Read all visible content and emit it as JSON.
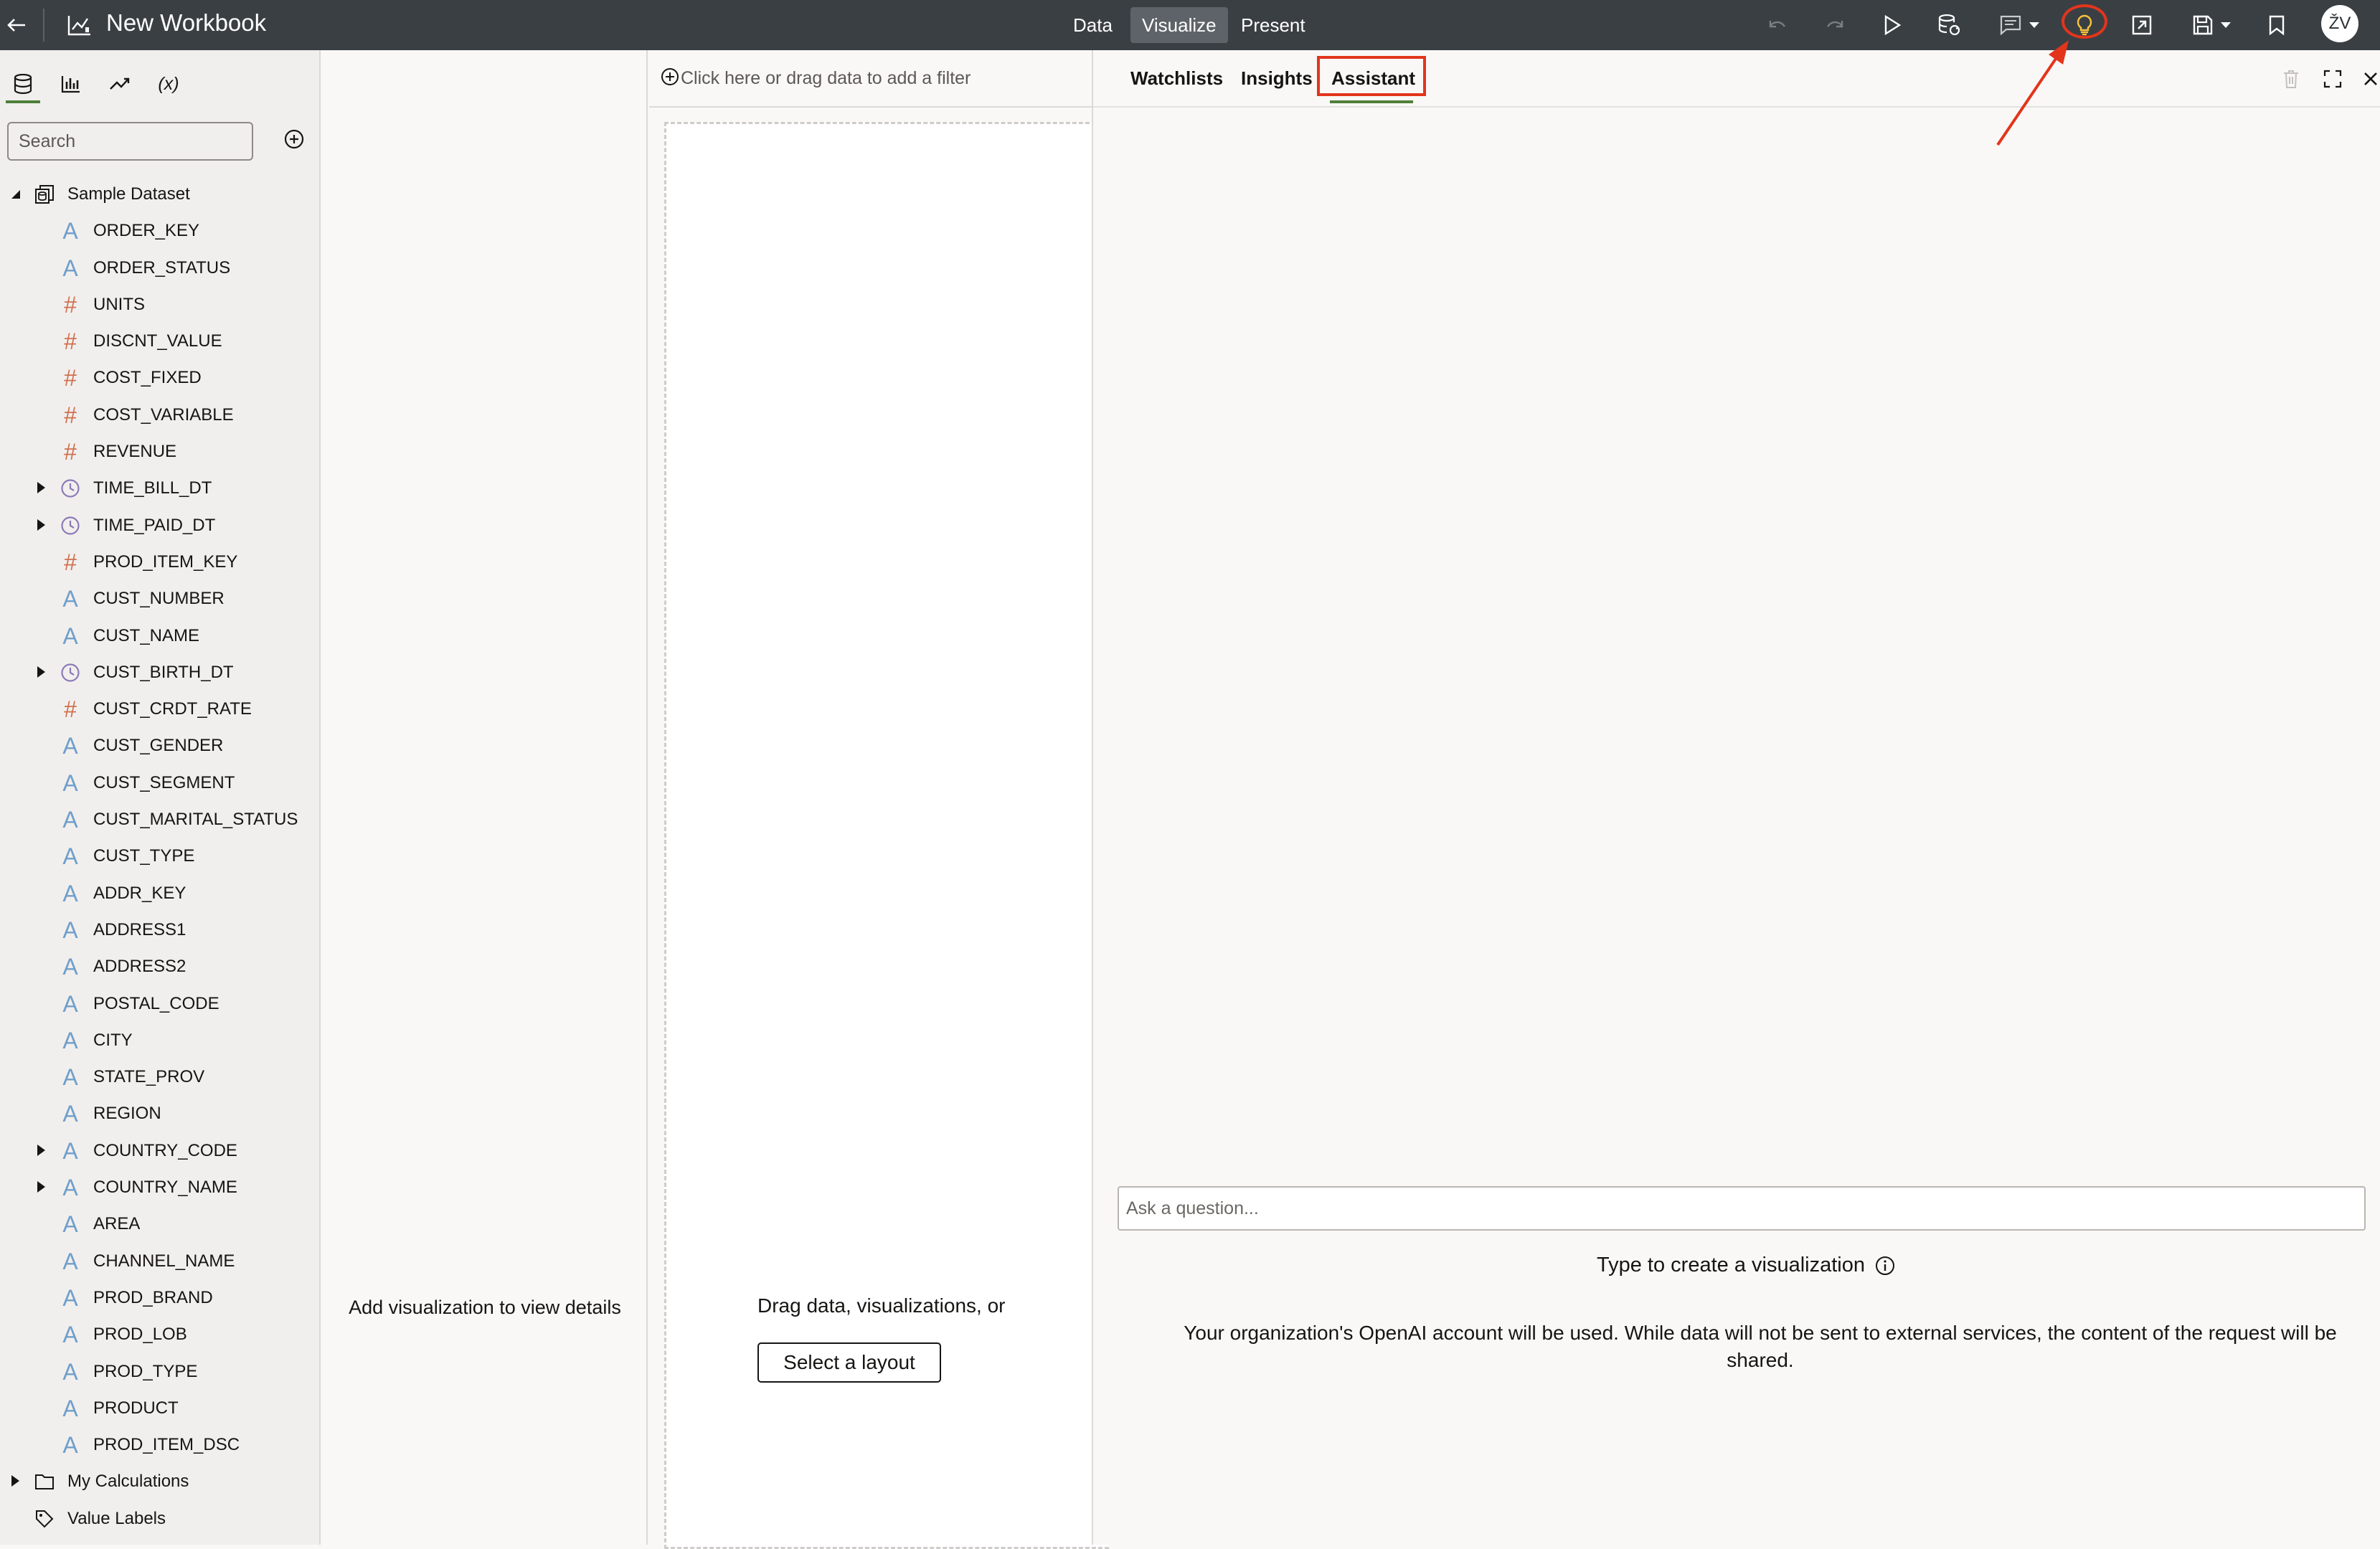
{
  "header": {
    "title": "New Workbook",
    "tabs": [
      {
        "label": "Data",
        "active": false
      },
      {
        "label": "Visualize",
        "active": true
      },
      {
        "label": "Present",
        "active": false
      }
    ],
    "avatar_initials": "ŽV",
    "icons": [
      "back-arrow-icon",
      "workbook-icon",
      "undo-icon",
      "redo-icon",
      "play-icon",
      "refresh-data-icon",
      "comment-icon",
      "insights-lightbulb-icon",
      "export-icon",
      "save-icon",
      "bookmark-icon"
    ]
  },
  "left_panel": {
    "tabs": [
      "data-icon",
      "visualizations-icon",
      "analytics-icon",
      "parameters-icon"
    ],
    "search_placeholder": "Search",
    "dataset_name": "Sample Dataset",
    "fields": [
      {
        "type": "attr",
        "name": "ORDER_KEY",
        "expandable": false
      },
      {
        "type": "attr",
        "name": "ORDER_STATUS",
        "expandable": false
      },
      {
        "type": "measure",
        "name": "UNITS",
        "expandable": false
      },
      {
        "type": "measure",
        "name": "DISCNT_VALUE",
        "expandable": false
      },
      {
        "type": "measure",
        "name": "COST_FIXED",
        "expandable": false
      },
      {
        "type": "measure",
        "name": "COST_VARIABLE",
        "expandable": false
      },
      {
        "type": "measure",
        "name": "REVENUE",
        "expandable": false
      },
      {
        "type": "time",
        "name": "TIME_BILL_DT",
        "expandable": true
      },
      {
        "type": "time",
        "name": "TIME_PAID_DT",
        "expandable": true
      },
      {
        "type": "measure",
        "name": "PROD_ITEM_KEY",
        "expandable": false
      },
      {
        "type": "attr",
        "name": "CUST_NUMBER",
        "expandable": false
      },
      {
        "type": "attr",
        "name": "CUST_NAME",
        "expandable": false
      },
      {
        "type": "time",
        "name": "CUST_BIRTH_DT",
        "expandable": true
      },
      {
        "type": "measure",
        "name": "CUST_CRDT_RATE",
        "expandable": false
      },
      {
        "type": "attr",
        "name": "CUST_GENDER",
        "expandable": false
      },
      {
        "type": "attr",
        "name": "CUST_SEGMENT",
        "expandable": false
      },
      {
        "type": "attr",
        "name": "CUST_MARITAL_STATUS",
        "expandable": false
      },
      {
        "type": "attr",
        "name": "CUST_TYPE",
        "expandable": false
      },
      {
        "type": "attr",
        "name": "ADDR_KEY",
        "expandable": false
      },
      {
        "type": "attr",
        "name": "ADDRESS1",
        "expandable": false
      },
      {
        "type": "attr",
        "name": "ADDRESS2",
        "expandable": false
      },
      {
        "type": "attr",
        "name": "POSTAL_CODE",
        "expandable": false
      },
      {
        "type": "attr",
        "name": "CITY",
        "expandable": false
      },
      {
        "type": "attr",
        "name": "STATE_PROV",
        "expandable": false
      },
      {
        "type": "attr",
        "name": "REGION",
        "expandable": false
      },
      {
        "type": "attr",
        "name": "COUNTRY_CODE",
        "expandable": true
      },
      {
        "type": "attr",
        "name": "COUNTRY_NAME",
        "expandable": true
      },
      {
        "type": "attr",
        "name": "AREA",
        "expandable": false
      },
      {
        "type": "attr",
        "name": "CHANNEL_NAME",
        "expandable": false
      },
      {
        "type": "attr",
        "name": "PROD_BRAND",
        "expandable": false
      },
      {
        "type": "attr",
        "name": "PROD_LOB",
        "expandable": false
      },
      {
        "type": "attr",
        "name": "PROD_TYPE",
        "expandable": false
      },
      {
        "type": "attr",
        "name": "PRODUCT",
        "expandable": false
      },
      {
        "type": "attr",
        "name": "PROD_ITEM_DSC",
        "expandable": false
      }
    ],
    "my_calculations": "My Calculations",
    "value_labels": "Value Labels"
  },
  "grammar_panel": {
    "message": "Add visualization to view details"
  },
  "canvas": {
    "filter_placeholder": "Click here or drag data to add a filter",
    "drop_message": "Drag data, visualizations, or",
    "layout_button": "Select a layout"
  },
  "right_panel": {
    "tabs": [
      "Watchlists",
      "Insights",
      "Assistant"
    ],
    "active_tab": "Assistant",
    "ask_placeholder": "Ask a question...",
    "hint": "Type to create a visualization",
    "disclaimer": "Your organization's OpenAI account will be used. While data will not be sent to external services, the content of the request will be shared."
  },
  "colors": {
    "header_bg": "#3a3f44",
    "annotation_red": "#e2351c",
    "active_underline": "#4f7f3a",
    "attr_icon": "#6f9fcc",
    "measure_icon": "#d0704f",
    "time_icon": "#8b7bb8"
  }
}
